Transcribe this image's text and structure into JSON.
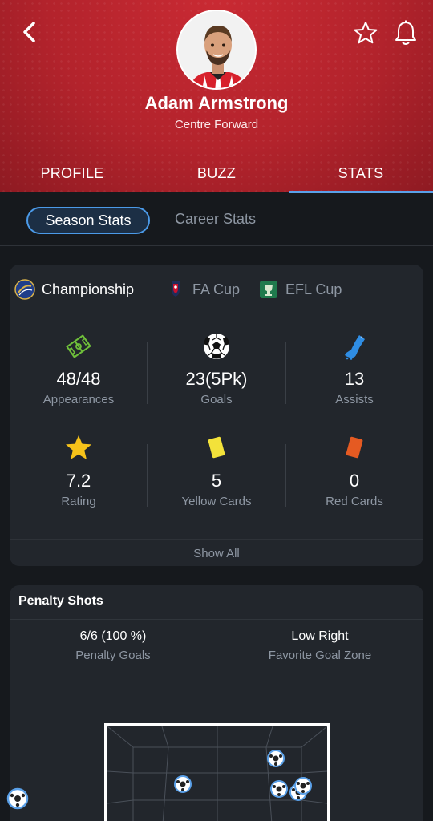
{
  "header": {
    "player_name": "Adam Armstrong",
    "position": "Centre Forward",
    "tabs": [
      {
        "label": "PROFILE"
      },
      {
        "label": "BUZZ"
      },
      {
        "label": "STATS"
      }
    ],
    "active_tab": "STATS"
  },
  "subtabs": {
    "season": "Season Stats",
    "career": "Career Stats",
    "active": "Season Stats"
  },
  "competitions": [
    {
      "label": "Championship",
      "icon": "championship-logo",
      "active": true
    },
    {
      "label": "FA Cup",
      "icon": "fa-cup-logo",
      "active": false
    },
    {
      "label": "EFL Cup",
      "icon": "efl-cup-logo",
      "active": false
    }
  ],
  "stats": [
    {
      "value": "48/48",
      "label": "Appearances",
      "icon": "pitch-icon"
    },
    {
      "value": "23(5Pk)",
      "label": "Goals",
      "icon": "football-icon"
    },
    {
      "value": "13",
      "label": "Assists",
      "icon": "boot-icon"
    },
    {
      "value": "7.2",
      "label": "Rating",
      "icon": "star-icon"
    },
    {
      "value": "5",
      "label": "Yellow Cards",
      "icon": "yellow-card-icon"
    },
    {
      "value": "0",
      "label": "Red Cards",
      "icon": "red-card-icon"
    }
  ],
  "show_all": "Show All",
  "penalty": {
    "title": "Penalty Shots",
    "goals_value": "6/6 (100 %)",
    "goals_label": "Penalty Goals",
    "zone_value": "Low Right",
    "zone_label": "Favorite Goal Zone"
  },
  "colors": {
    "header_red": "#b3232c",
    "accent_blue": "#4b9ae8",
    "background": "#16191d",
    "card": "#22262c",
    "muted_text": "#8e97a3"
  }
}
